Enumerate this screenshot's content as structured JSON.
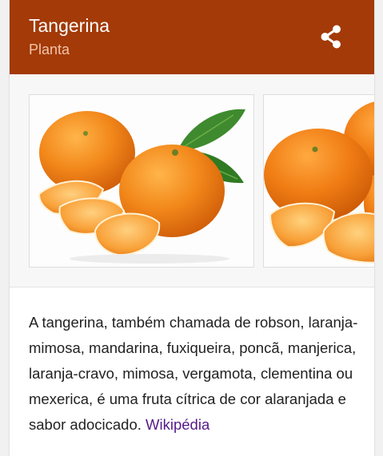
{
  "header": {
    "title": "Tangerina",
    "subtitle": "Planta",
    "share_icon": "share-icon"
  },
  "gallery": {
    "images": [
      "tangerine-photo-icon",
      "tangerine-photo-icon"
    ]
  },
  "description": {
    "text": "A tangerina, também chamada de robson, laranja-mimosa, mandarina, fuxiqueira, poncã, manjerica, laranja-cravo, mimosa, vergamota, clementina ou mexerica, é uma fruta cítrica de cor alaranjada e sabor adocicado.",
    "source_link": "Wikipédia"
  },
  "colors": {
    "header_bg": "#a33a07",
    "link": "#551a8b",
    "orange": "#f2871a"
  }
}
